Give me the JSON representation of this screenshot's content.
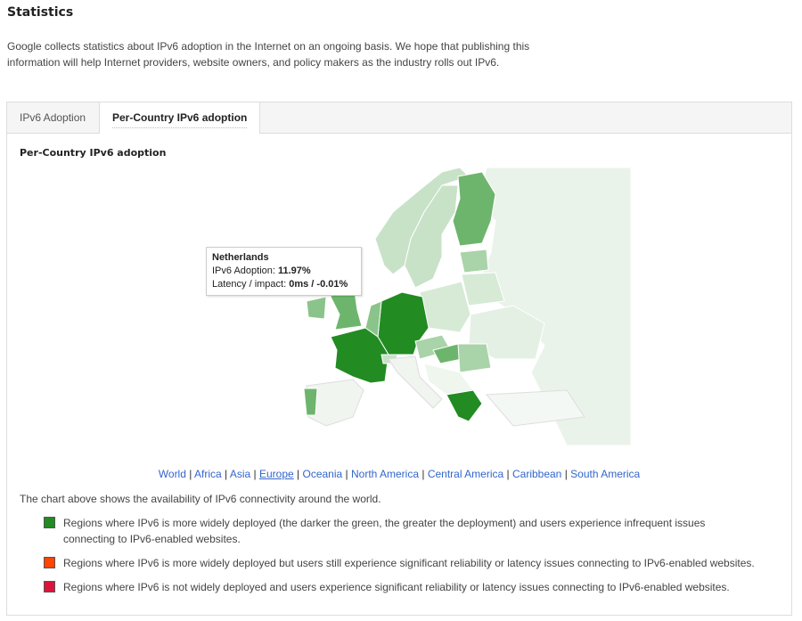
{
  "page": {
    "title": "Statistics",
    "intro": "Google collects statistics about IPv6 adoption in the Internet on an ongoing basis. We hope that publishing this information will help Internet providers, website owners, and policy makers as the industry rolls out IPv6."
  },
  "tabs": [
    {
      "label": "IPv6 Adoption",
      "active": false
    },
    {
      "label": "Per-Country IPv6 adoption",
      "active": true
    }
  ],
  "section_title": "Per-Country IPv6 adoption",
  "map": {
    "region": "Europe",
    "colors": {
      "high": "#228b22",
      "medium": "#6db56d",
      "low": "#a9d3a9",
      "verylow": "#d6ead6",
      "none": "#f0f5f0"
    }
  },
  "tooltip": {
    "country": "Netherlands",
    "adoption_label": "IPv6 Adoption: ",
    "adoption_value": "11.97%",
    "latency_label": "Latency / impact: ",
    "latency_value": "0ms / -0.01%"
  },
  "region_links": [
    {
      "label": "World"
    },
    {
      "label": "Africa"
    },
    {
      "label": "Asia"
    },
    {
      "label": "Europe",
      "current": true
    },
    {
      "label": "Oceania"
    },
    {
      "label": "North America"
    },
    {
      "label": "Central America"
    },
    {
      "label": "Caribbean"
    },
    {
      "label": "South America"
    }
  ],
  "description": "The chart above shows the availability of IPv6 connectivity around the world.",
  "legend": [
    {
      "color": "#228b22",
      "text": "Regions where IPv6 is more widely deployed (the darker the green, the greater the deployment) and users experience infrequent issues connecting to IPv6-enabled websites."
    },
    {
      "color": "#ff4500",
      "text": "Regions where IPv6 is more widely deployed but users still experience significant reliability or latency issues connecting to IPv6-enabled websites."
    },
    {
      "color": "#dc143c",
      "text": "Regions where IPv6 is not widely deployed and users experience significant reliability or latency issues connecting to IPv6-enabled websites."
    }
  ]
}
